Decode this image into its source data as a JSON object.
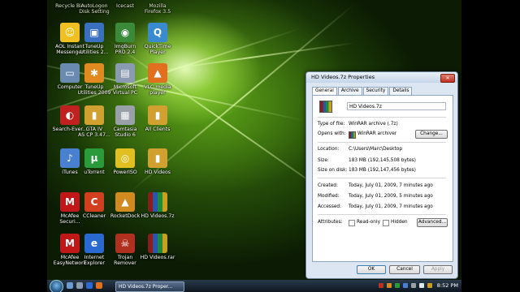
{
  "desktop": {
    "icons": [
      {
        "label": "Recycle Bin",
        "color": "#7a8a6a",
        "glyph": ""
      },
      {
        "label": "AutoLogon\nDisk Setting",
        "color": "#6a7a8a",
        "glyph": ""
      },
      {
        "label": "Icecast",
        "color": "#7a6a4a",
        "glyph": ""
      },
      {
        "label": "Mozilla\nFirefox 3.5",
        "color": "#b06a20",
        "glyph": ""
      },
      {
        "label": "AOL Instant\nMessenger",
        "color": "#f0c020",
        "glyph": "☺"
      },
      {
        "label": "TuneUp\nUtilities 2...",
        "color": "#3a70c0",
        "glyph": "▣"
      },
      {
        "label": "ImgBurn\nPRO 2.4",
        "color": "#3a8a3a",
        "glyph": "◉"
      },
      {
        "label": "QuickTime\nPlayer",
        "color": "#3a8ad0",
        "glyph": "Q"
      },
      {
        "label": "Computer",
        "color": "#6a8ab0",
        "glyph": "▭"
      },
      {
        "label": "TuneUp\nUtilities 2009",
        "color": "#e08a20",
        "glyph": "✱"
      },
      {
        "label": "Microsoft\nVirtual PC",
        "color": "#8a9ab0",
        "glyph": "▤"
      },
      {
        "label": "VLC media\nplayer",
        "color": "#e07020",
        "glyph": "▲"
      },
      {
        "label": "Search-Ever...",
        "color": "#c02020",
        "glyph": "◐"
      },
      {
        "label": "GTA IV\nAS CP 3.47...",
        "color": "#d0a030",
        "glyph": "▮"
      },
      {
        "label": "Camtasia\nStudio 6",
        "color": "#9aa0a8",
        "glyph": "▦"
      },
      {
        "label": "All Clients",
        "color": "#d0a030",
        "glyph": "▮"
      },
      {
        "label": "iTunes",
        "color": "#4a80d0",
        "glyph": "♪"
      },
      {
        "label": "uTorrent",
        "color": "#2a9a3a",
        "glyph": "µ"
      },
      {
        "label": "PowerISO",
        "color": "#e0c020",
        "glyph": "◎"
      },
      {
        "label": "HD Videos",
        "color": "#d0a030",
        "glyph": "▮"
      },
      {
        "label": "McAfee\nSecuri...",
        "color": "#c01818",
        "glyph": "M"
      },
      {
        "label": "CCleaner",
        "color": "#d04020",
        "glyph": "C"
      },
      {
        "label": "RocketDock",
        "color": "#d08a20",
        "glyph": "▲"
      },
      {
        "label": "HD Videos.7z",
        "color": "#8a1c1c",
        "glyph": ""
      },
      {
        "label": "McAfee\nEasyNetwork",
        "color": "#c01818",
        "glyph": "M"
      },
      {
        "label": "Internet\nExplorer",
        "color": "#2a6ad0",
        "glyph": "e"
      },
      {
        "label": "Trojan\nRemover",
        "color": "#b03020",
        "glyph": "☠"
      },
      {
        "label": "HD Videos.rar",
        "color": "#8a1c1c",
        "glyph": ""
      }
    ]
  },
  "dialog": {
    "title": "HD Videos.7z Properties",
    "close_label": "✕",
    "tabs": [
      "General",
      "Archive",
      "Security",
      "Details"
    ],
    "file_name": "HD Videos.7z",
    "type_label": "Type of file:",
    "type_value": "WinRAR archive (.7z)",
    "opens_label": "Opens with:",
    "opens_value": "WinRAR archiver",
    "change_button": "Change...",
    "location_label": "Location:",
    "location_value": "C:\\Users\\Marc\\Desktop",
    "size_label": "Size:",
    "size_value": "183 MB (192,145,508 bytes)",
    "size_on_disk_label": "Size on disk:",
    "size_on_disk_value": "183 MB (192,147,456 bytes)",
    "created_label": "Created:",
    "created_value": "Today, July 01, 2009, 7 minutes ago",
    "modified_label": "Modified:",
    "modified_value": "Today, July 01, 2009, 5 minutes ago",
    "accessed_label": "Accessed:",
    "accessed_value": "Today, July 01, 2009, 7 minutes ago",
    "attributes_label": "Attributes:",
    "readonly_label": "Read-only",
    "hidden_label": "Hidden",
    "advanced_button": "Advanced...",
    "ok_button": "OK",
    "cancel_button": "Cancel",
    "apply_button": "Apply"
  },
  "taskbar": {
    "task_label": "HD Videos.7z Proper...",
    "clock": "8:52 PM"
  }
}
